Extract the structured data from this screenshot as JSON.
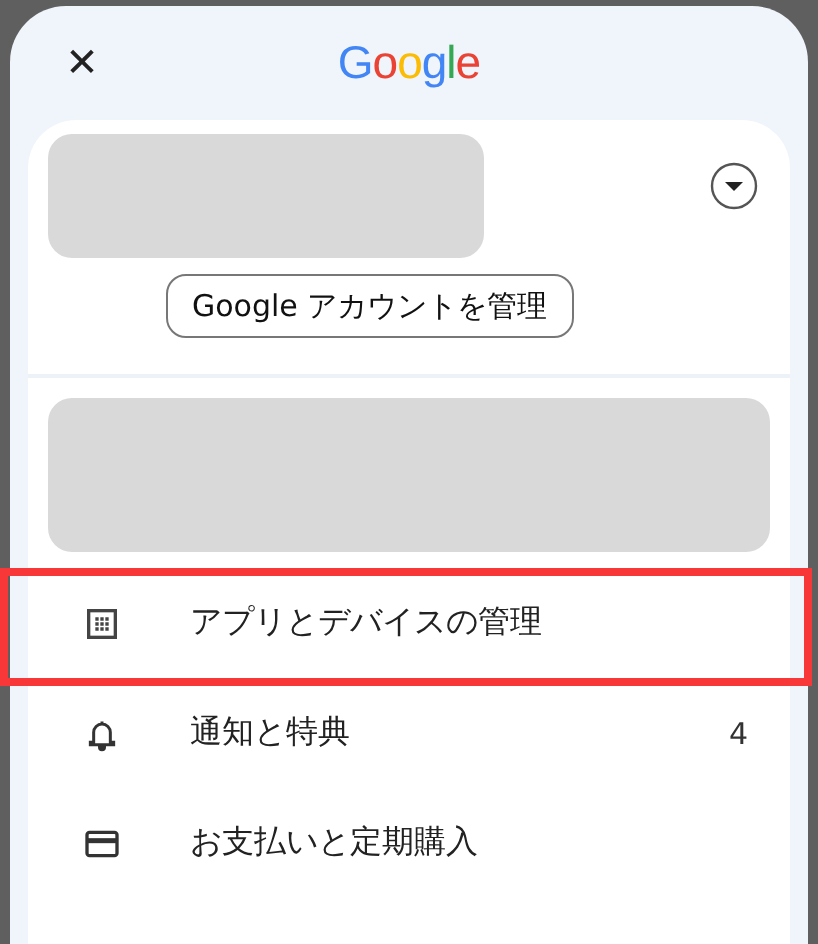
{
  "header": {
    "close": "✕",
    "logo": "Google"
  },
  "account": {
    "manage_button": "Google アカウントを管理"
  },
  "menu": [
    {
      "kind": "apps",
      "label": "アプリとデバイスの管理",
      "highlighted": true
    },
    {
      "kind": "bell",
      "label": "通知と特典",
      "count": "4",
      "highlighted": false
    },
    {
      "kind": "card",
      "label": "お支払いと定期購入",
      "highlighted": false
    }
  ]
}
